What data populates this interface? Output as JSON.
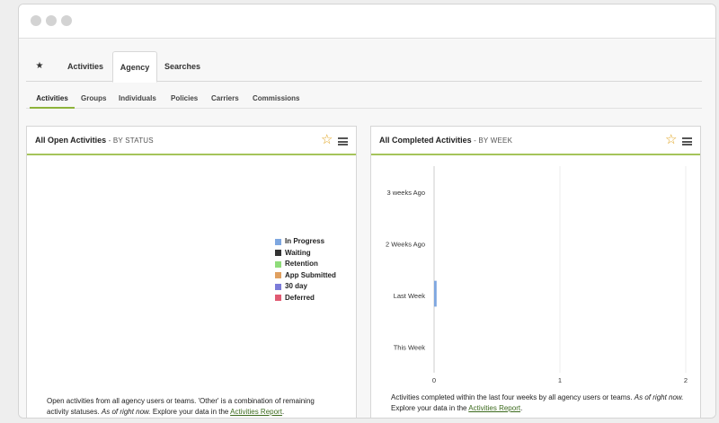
{
  "tabs": [
    {
      "label": "★"
    },
    {
      "label": "Activities"
    },
    {
      "label": "Agency",
      "active": true
    },
    {
      "label": "Searches"
    }
  ],
  "subtabs": [
    {
      "label": "Activities",
      "active": true
    },
    {
      "label": "Groups"
    },
    {
      "label": "Individuals"
    },
    {
      "label": "Policies"
    },
    {
      "label": "Carriers"
    },
    {
      "label": "Commissions"
    }
  ],
  "open_panel": {
    "title": "All Open Activities",
    "subtitle": " - BY STATUS",
    "legend": [
      {
        "label": "In Progress",
        "color": "#7ea7e0"
      },
      {
        "label": "Waiting",
        "color": "#333333"
      },
      {
        "label": "Retention",
        "color": "#8fdc7a"
      },
      {
        "label": "App Submitted",
        "color": "#e0a060"
      },
      {
        "label": "30 day",
        "color": "#7b7bd9"
      },
      {
        "label": "Deferred",
        "color": "#e05a72"
      }
    ],
    "footnote_text": "Open activities from all agency users or teams. 'Other' is a combination of remaining activity statuses.",
    "footnote_italic": "As of right now.",
    "footnote_text2": "Explore your data in the",
    "footnote_link": "Activities Report",
    "footnote_end": "."
  },
  "completed_panel": {
    "title": "All Completed Activities",
    "subtitle": " - BY WEEK",
    "footnote_text": "Activities completed within the last four weeks by all agency users or teams.",
    "footnote_italic": "As of right now.",
    "footnote_text2": "Explore your data in the",
    "footnote_link": "Activities Report",
    "footnote_end": "."
  },
  "chart_data": {
    "type": "bar",
    "orientation": "horizontal",
    "categories": [
      "3 weeks Ago",
      "2 Weeks Ago",
      "Last Week",
      "This Week"
    ],
    "values": [
      0,
      0,
      0.02,
      0
    ],
    "x_ticks": [
      "0",
      "1",
      "2"
    ],
    "xlim": [
      0,
      2
    ],
    "bar_color": "#7ea7e0",
    "grid": true
  }
}
